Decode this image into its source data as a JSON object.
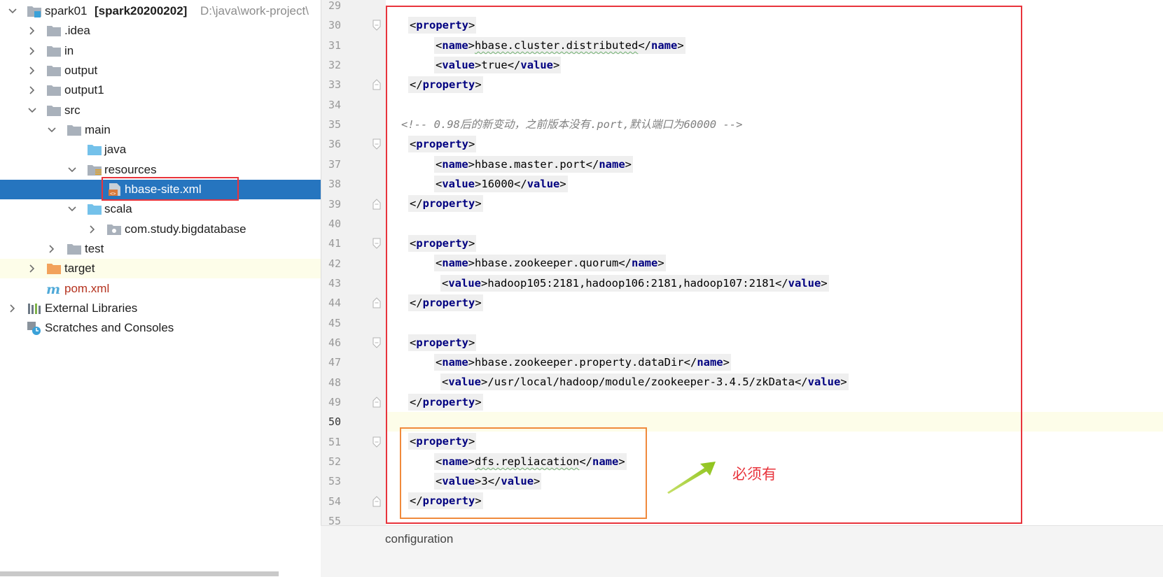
{
  "project_tree": {
    "root": {
      "name": "spark01",
      "module": "[spark20200202]",
      "path": "D:\\java\\work-project\\"
    },
    "items": [
      {
        "label": ".idea"
      },
      {
        "label": "in"
      },
      {
        "label": "output"
      },
      {
        "label": "output1"
      },
      {
        "label": "src"
      },
      {
        "label": "main"
      },
      {
        "label": "java"
      },
      {
        "label": "resources"
      },
      {
        "label": "hbase-site.xml"
      },
      {
        "label": "scala"
      },
      {
        "label": "com.study.bigdatabase"
      },
      {
        "label": "test"
      },
      {
        "label": "target"
      },
      {
        "label": "pom.xml"
      },
      {
        "label": "External Libraries"
      },
      {
        "label": "Scratches and Consoles"
      }
    ]
  },
  "editor": {
    "line_numbers": [
      "29",
      "30",
      "31",
      "32",
      "33",
      "34",
      "35",
      "36",
      "37",
      "38",
      "39",
      "40",
      "41",
      "42",
      "43",
      "44",
      "45",
      "46",
      "47",
      "48",
      "49",
      "50",
      "51",
      "52",
      "53",
      "54",
      "55"
    ],
    "comment": "<!-- 0.98后的新变动，之前版本没有.port,默认端口为60000 -->",
    "tags": {
      "property": "property",
      "name": "name",
      "value": "value"
    },
    "values": {
      "n31": "hbase.cluster.distributed",
      "v32": "true",
      "n37": "hbase.master.port",
      "v38": "16000",
      "n42": "hbase.zookeeper.quorum",
      "v43": "hadoop105:2181,hadoop106:2181,hadoop107:2181",
      "n47": "hbase.zookeeper.property.dataDir",
      "v48": "/usr/local/hadoop/module/zookeeper-3.4.5/zkData",
      "n52": "dfs.repliacation",
      "v53": "3"
    }
  },
  "annotation": {
    "note": "必须有"
  },
  "breadcrumb": {
    "label": "configuration"
  },
  "colors": {
    "selection": "#2675bf",
    "tag": "#000080",
    "comment": "#808080",
    "annotation_red": "#e8343c",
    "annotation_orange": "#f08a3c"
  }
}
